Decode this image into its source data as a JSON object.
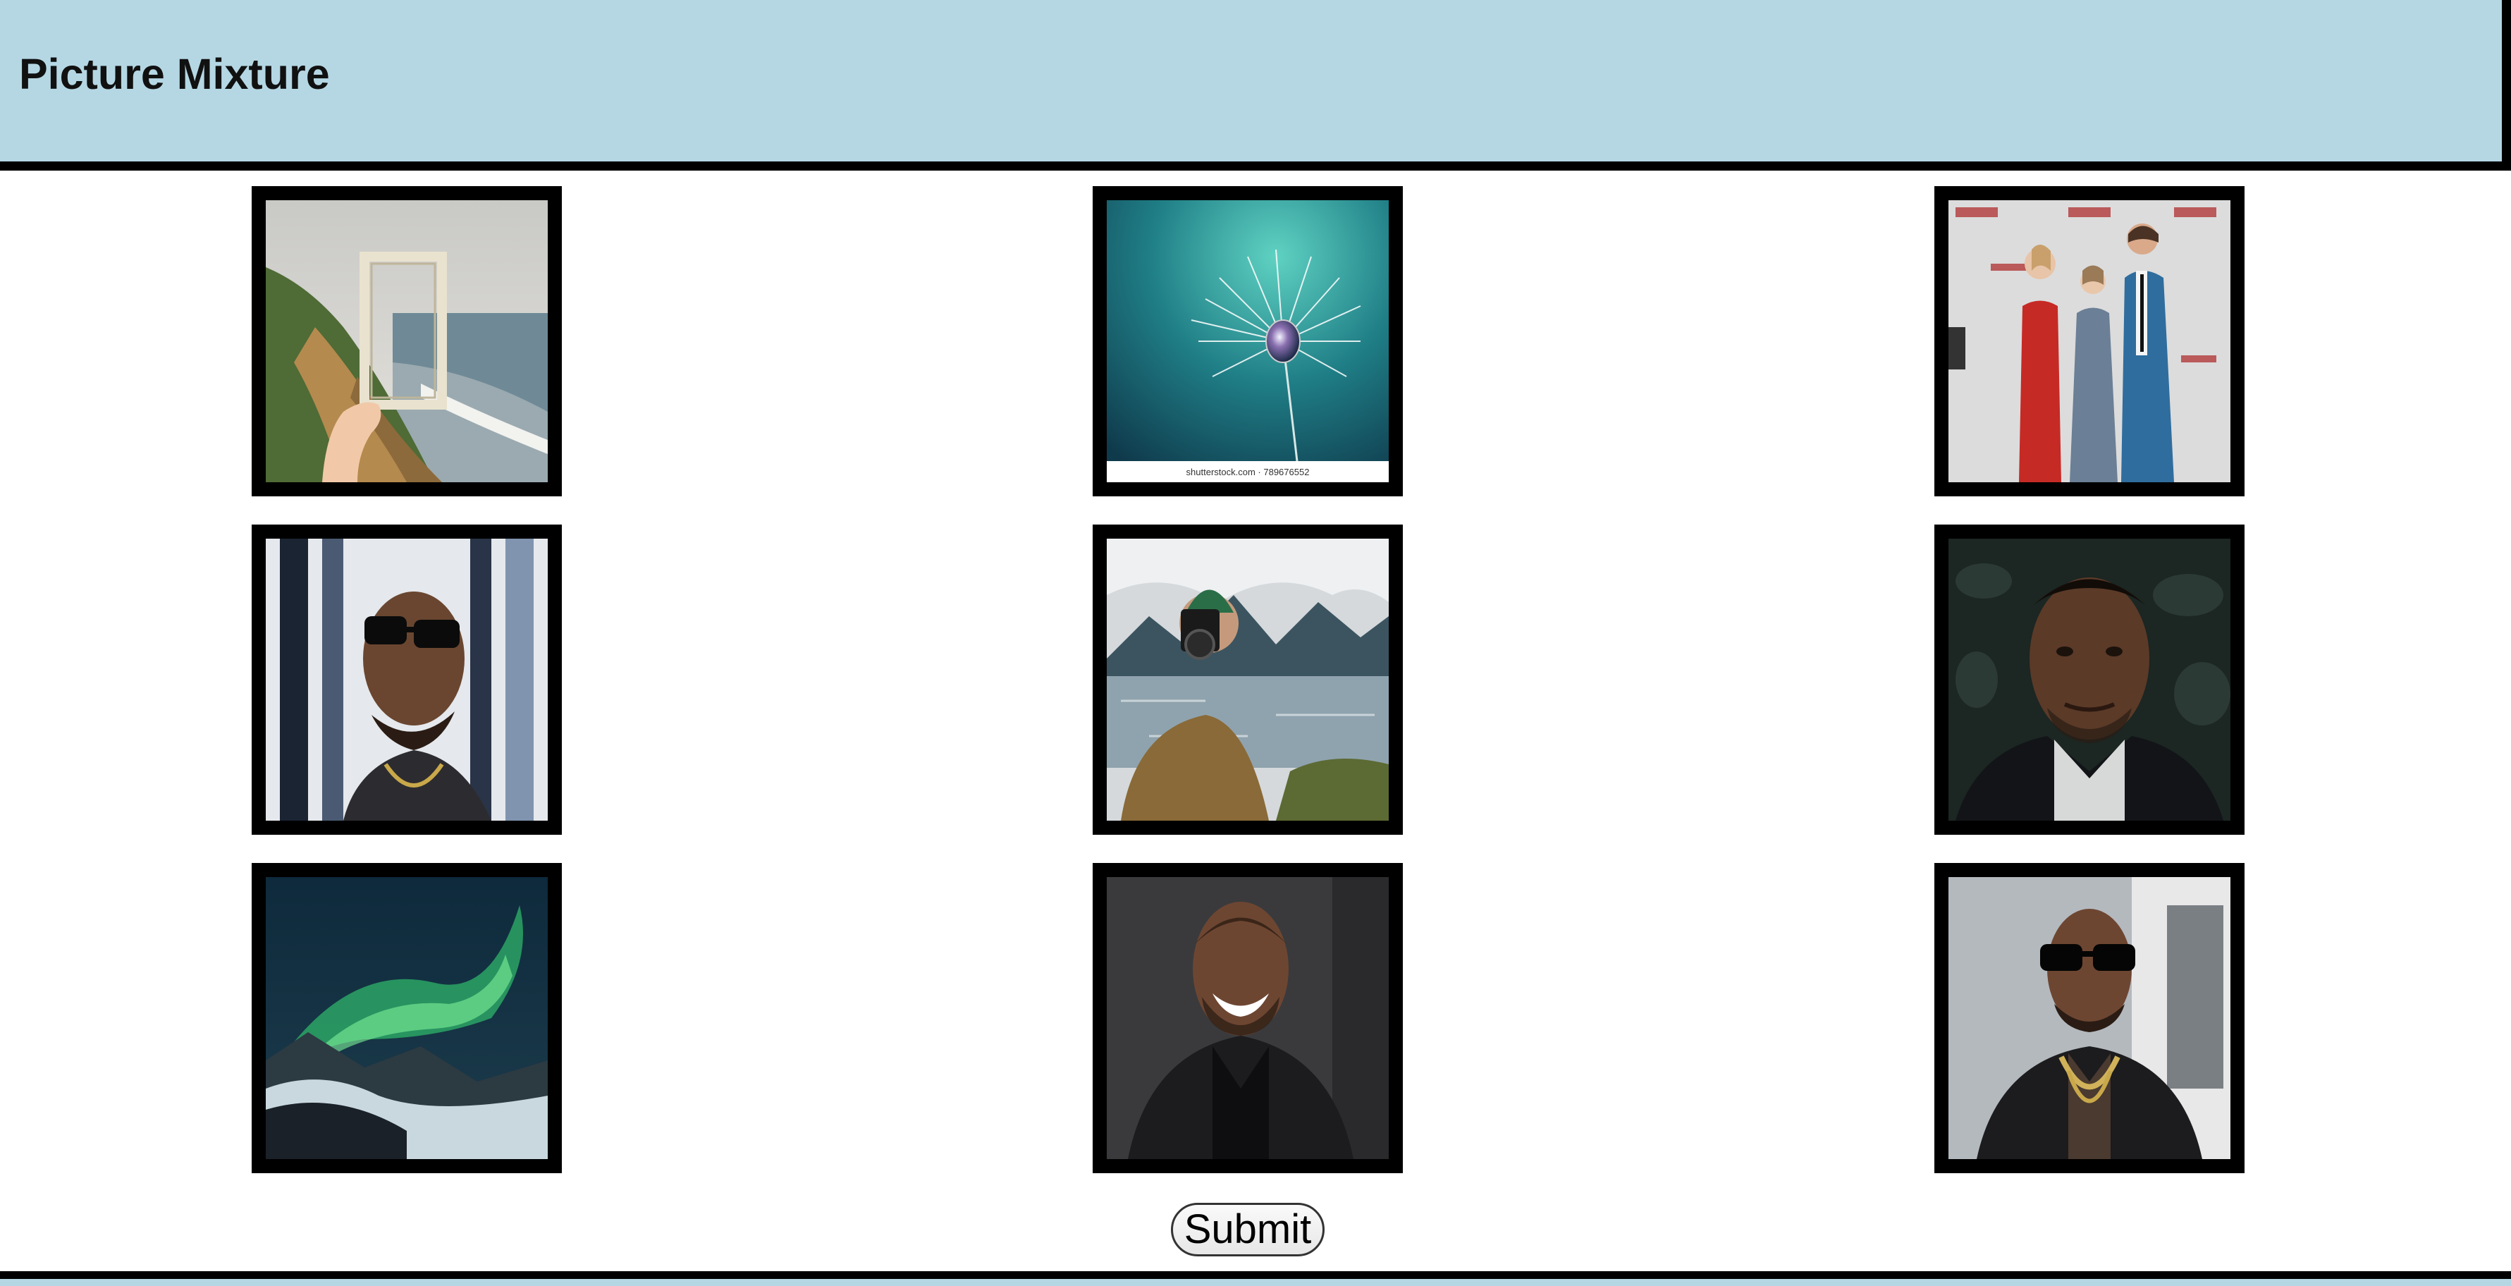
{
  "header": {
    "title": "Picture Mixture"
  },
  "images": [
    {
      "icon": "frame-on-coastal-cliff-photo",
      "caption": ""
    },
    {
      "icon": "dandelion-seed-with-water-drop-photo",
      "caption": "shutterstock.com · 789676552"
    },
    {
      "icon": "three-people-red-carpet-photo",
      "caption": ""
    },
    {
      "icon": "man-in-sunglasses-portrait-photo",
      "caption": ""
    },
    {
      "icon": "photographer-by-lake-photo",
      "caption": ""
    },
    {
      "icon": "man-portrait-photo",
      "caption": ""
    },
    {
      "icon": "aurora-over-mountains-photo",
      "caption": ""
    },
    {
      "icon": "smiling-man-in-coat-photo",
      "caption": ""
    },
    {
      "icon": "man-in-sunglasses-chain-photo",
      "caption": ""
    }
  ],
  "form": {
    "submit_label": "Submit"
  },
  "colors": {
    "header_bg": "#b5d7e4",
    "tile_border": "#000000"
  }
}
